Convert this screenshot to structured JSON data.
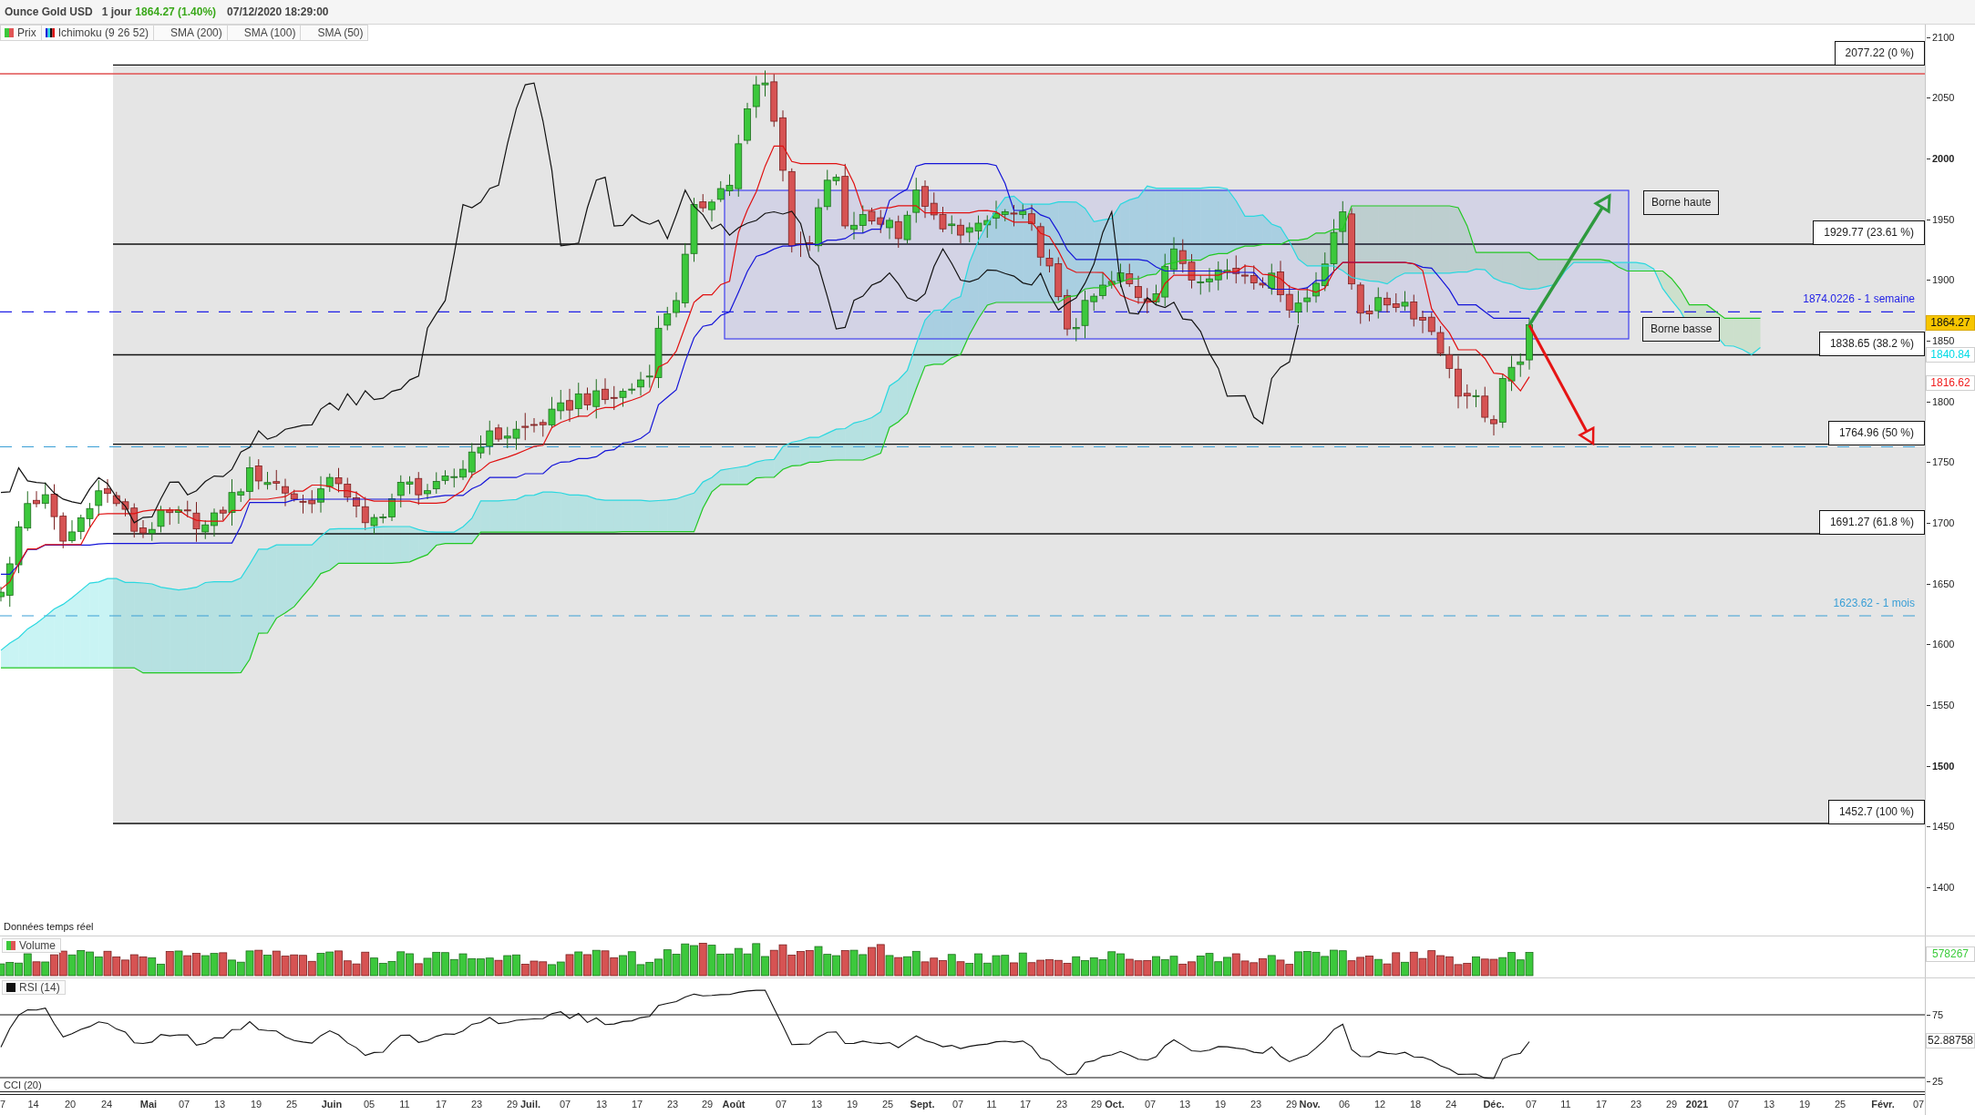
{
  "header": {
    "instrument": "Ounce Gold USD",
    "period": "1 jour",
    "change": "1864.27 (1.40%)",
    "timestamp": "07/12/2020 18:29:00"
  },
  "legend": [
    {
      "label": "Prix",
      "kind": "candles"
    },
    {
      "label": "Ichimoku (9 26 52)",
      "kind": "ichimoku"
    },
    {
      "label": "SMA (200)",
      "kind": "none"
    },
    {
      "label": "SMA (100)",
      "kind": "none"
    },
    {
      "label": "SMA (50)",
      "kind": "none"
    }
  ],
  "price_panel": {
    "y_axis": [
      {
        "label": "2100",
        "bold": false
      },
      {
        "label": "2050",
        "bold": false
      },
      {
        "label": "2000",
        "bold": true
      },
      {
        "label": "1950",
        "bold": false
      },
      {
        "label": "1900",
        "bold": false
      },
      {
        "label": "1850",
        "bold": false
      },
      {
        "label": "1800",
        "bold": false
      },
      {
        "label": "1750",
        "bold": false
      },
      {
        "label": "1700",
        "bold": false
      },
      {
        "label": "1650",
        "bold": false
      },
      {
        "label": "1600",
        "bold": false
      },
      {
        "label": "1550",
        "bold": false
      },
      {
        "label": "1500",
        "bold": true
      },
      {
        "label": "1450",
        "bold": false
      },
      {
        "label": "1400",
        "bold": false
      }
    ],
    "fibonacci_levels": [
      "2077.22 (0 %)",
      "1929.77 (23.61 %)",
      "1838.65 (38.2 %)",
      "1764.96 (50 %)",
      "1691.27 (61.8 %)",
      "1452.7 (100 %)"
    ],
    "reference_lines": [
      {
        "label": "1874.0226 - 1 semaine",
        "color": "#1f1fe6"
      },
      {
        "label": "1623.62 - 1 mois",
        "color": "#3a9fd6"
      }
    ],
    "annotations": [
      "Borne haute",
      "Borne basse"
    ],
    "value_badges": [
      {
        "label": "1864.27",
        "kind": "last_price"
      },
      {
        "label": "1840.84",
        "kind": "senkou_a"
      },
      {
        "label": "1816.62",
        "kind": "tenkan"
      }
    ],
    "notice": "Données temps réel"
  },
  "volume_panel": {
    "legend": {
      "label": "Volume",
      "kind": "candles"
    },
    "badge": "578267"
  },
  "rsi_panel": {
    "legend": {
      "label": "RSI (14)",
      "kind": "solid"
    },
    "y_axis": [
      "75",
      "25"
    ],
    "badge": "52.88758"
  },
  "cci_panel": {
    "legend": "CCI (20)"
  },
  "x_axis": [
    {
      "label": "7",
      "bold": false
    },
    {
      "label": "14",
      "bold": false
    },
    {
      "label": "20",
      "bold": false
    },
    {
      "label": "24",
      "bold": false
    },
    {
      "label": "Mai",
      "bold": true
    },
    {
      "label": "07",
      "bold": false
    },
    {
      "label": "13",
      "bold": false
    },
    {
      "label": "19",
      "bold": false
    },
    {
      "label": "25",
      "bold": false
    },
    {
      "label": "Juin",
      "bold": true
    },
    {
      "label": "05",
      "bold": false
    },
    {
      "label": "11",
      "bold": false
    },
    {
      "label": "17",
      "bold": false
    },
    {
      "label": "23",
      "bold": false
    },
    {
      "label": "29",
      "bold": false
    },
    {
      "label": "Juil.",
      "bold": true
    },
    {
      "label": "07",
      "bold": false
    },
    {
      "label": "13",
      "bold": false
    },
    {
      "label": "17",
      "bold": false
    },
    {
      "label": "23",
      "bold": false
    },
    {
      "label": "29",
      "bold": false
    },
    {
      "label": "Août",
      "bold": true
    },
    {
      "label": "07",
      "bold": false
    },
    {
      "label": "13",
      "bold": false
    },
    {
      "label": "19",
      "bold": false
    },
    {
      "label": "25",
      "bold": false
    },
    {
      "label": "Sept.",
      "bold": true
    },
    {
      "label": "07",
      "bold": false
    },
    {
      "label": "11",
      "bold": false
    },
    {
      "label": "17",
      "bold": false
    },
    {
      "label": "23",
      "bold": false
    },
    {
      "label": "29",
      "bold": false
    },
    {
      "label": "Oct.",
      "bold": true
    },
    {
      "label": "07",
      "bold": false
    },
    {
      "label": "13",
      "bold": false
    },
    {
      "label": "19",
      "bold": false
    },
    {
      "label": "23",
      "bold": false
    },
    {
      "label": "29",
      "bold": false
    },
    {
      "label": "Nov.",
      "bold": true
    },
    {
      "label": "06",
      "bold": false
    },
    {
      "label": "12",
      "bold": false
    },
    {
      "label": "18",
      "bold": false
    },
    {
      "label": "24",
      "bold": false
    },
    {
      "label": "Déc.",
      "bold": true
    },
    {
      "label": "07",
      "bold": false
    },
    {
      "label": "11",
      "bold": false
    },
    {
      "label": "17",
      "bold": false
    },
    {
      "label": "23",
      "bold": false
    },
    {
      "label": "29",
      "bold": false
    },
    {
      "label": "2021",
      "bold": true
    },
    {
      "label": "07",
      "bold": false
    },
    {
      "label": "13",
      "bold": false
    },
    {
      "label": "19",
      "bold": false
    },
    {
      "label": "25",
      "bold": false
    },
    {
      "label": "Févr.",
      "bold": true
    },
    {
      "label": "07",
      "bold": false
    }
  ]
}
